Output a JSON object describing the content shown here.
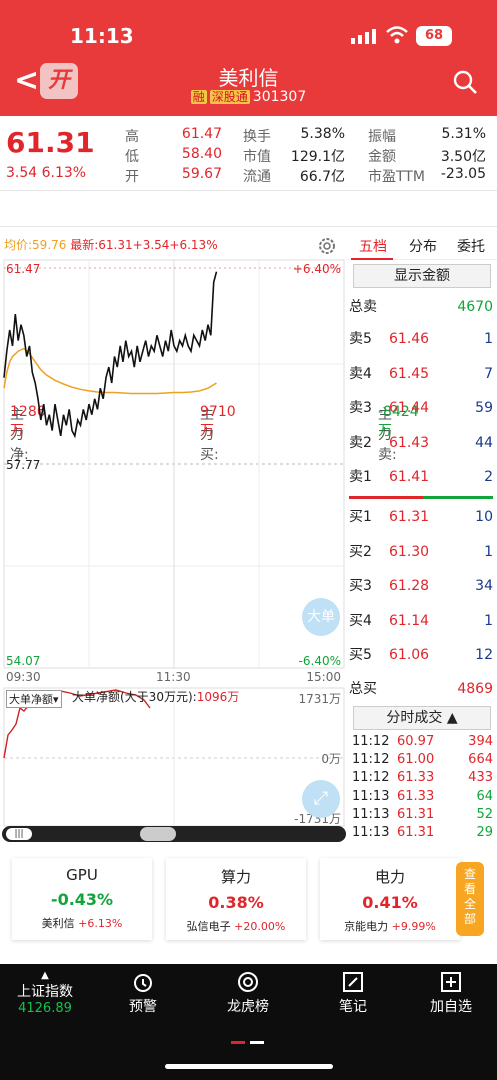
{
  "status": {
    "time": "11:13",
    "battery": "68"
  },
  "header": {
    "back_glyph": "<",
    "kai_label": "开",
    "title": "美利信",
    "tag_rong": "融",
    "tag_sgt": "深股通",
    "code": "301307"
  },
  "quote": {
    "price": "61.31",
    "change": "3.54",
    "change_pct": "6.13%",
    "fields": [
      {
        "label": "高",
        "value": "61.47",
        "color": "red"
      },
      {
        "label": "低",
        "value": "58.40",
        "color": "red"
      },
      {
        "label": "开",
        "value": "59.67",
        "color": "red"
      },
      {
        "label": "换手",
        "value": "5.38%",
        "color": "dark"
      },
      {
        "label": "市值",
        "value": "129.1亿",
        "color": "dark"
      },
      {
        "label": "流通",
        "value": "66.7亿",
        "color": "dark"
      },
      {
        "label": "振幅",
        "value": "5.31%",
        "color": "dark"
      },
      {
        "label": "金额",
        "value": "3.50亿",
        "color": "dark"
      },
      {
        "label": "市盈TTM",
        "value": "-23.05",
        "color": "dark"
      }
    ]
  },
  "flow": {
    "net_label": "主力净:",
    "net_value": "1286万",
    "buy_label": "主力买:",
    "buy_value": "9710万",
    "sell_label": "主力卖:",
    "sell_value": "-8424万"
  },
  "chart": {
    "avg_label": "均价:59.76",
    "last_label": "最新:61.31",
    "last_chg": "+3.54",
    "last_pct": "+6.13%",
    "y_top": "61.47",
    "y_mid": "57.77",
    "y_bot": "54.07",
    "pct_top": "+6.40%",
    "pct_bot": "-6.40%",
    "t_start": "09:30",
    "t_mid": "11:30",
    "t_end": "15:00",
    "big_order_btn": "大单",
    "sub_select": "大单净额",
    "sub_title": "大单净额(大于30万元):",
    "sub_value": "1096万",
    "sub_top": "1731万",
    "sub_zero": "0万",
    "sub_bot": "-1731万"
  },
  "chart_data": {
    "type": "line",
    "title": "",
    "xlabel": "",
    "ylabel": "",
    "x_ticks": [
      "09:30",
      "11:30",
      "15:00"
    ],
    "ylim": [
      54.07,
      61.47
    ],
    "series": [
      {
        "name": "price",
        "color": "#111111",
        "x": [
          0,
          2,
          4,
          6,
          8,
          10,
          12,
          14,
          16,
          18,
          20,
          22,
          24,
          26,
          28,
          30,
          32,
          34,
          36,
          38,
          40,
          42,
          44,
          46,
          48,
          50,
          52,
          54,
          56,
          58,
          60,
          62,
          64,
          66,
          68,
          70,
          72,
          74,
          76,
          78,
          80,
          82,
          84,
          86,
          88,
          90,
          92,
          94,
          96,
          98,
          100,
          102,
          104,
          106,
          108,
          110,
          112,
          114,
          116,
          118,
          120,
          122,
          124,
          126,
          128,
          130,
          132,
          134,
          136,
          138,
          140,
          142,
          144,
          146,
          148,
          150
        ],
        "values": [
          59.4,
          59.9,
          60.3,
          60.0,
          60.6,
          60.1,
          60.4,
          60.2,
          59.8,
          60.0,
          59.5,
          59.3,
          59.0,
          58.6,
          58.9,
          58.5,
          58.7,
          58.4,
          58.9,
          58.6,
          58.3,
          58.7,
          58.5,
          58.8,
          58.4,
          58.3,
          58.6,
          58.5,
          58.8,
          58.6,
          58.9,
          58.7,
          59.0,
          58.8,
          59.2,
          59.0,
          59.4,
          59.6,
          59.3,
          59.8,
          59.6,
          60.0,
          59.7,
          60.1,
          59.8,
          59.9,
          59.6,
          60.0,
          59.7,
          59.9,
          60.1,
          59.8,
          60.0,
          59.9,
          60.2,
          60.0,
          59.8,
          60.1,
          59.9,
          60.3,
          60.0,
          59.9,
          60.1,
          60.0,
          60.2,
          60.0,
          59.9,
          60.2,
          60.1,
          60.0,
          60.3,
          60.1,
          60.4,
          60.2,
          61.2,
          61.4
        ]
      },
      {
        "name": "avg",
        "color": "#f0a020",
        "x": [
          0,
          2,
          4,
          6,
          10,
          14,
          18,
          22,
          26,
          30,
          36,
          42,
          48,
          54,
          60,
          66,
          72,
          78,
          84,
          90,
          96,
          102,
          108,
          114,
          120,
          126,
          132,
          138,
          144,
          150
        ],
        "values": [
          59.2,
          59.5,
          59.7,
          59.8,
          59.9,
          59.95,
          59.85,
          59.7,
          59.55,
          59.45,
          59.35,
          59.28,
          59.22,
          59.18,
          59.15,
          59.13,
          59.12,
          59.12,
          59.11,
          59.1,
          59.1,
          59.1,
          59.1,
          59.11,
          59.12,
          59.12,
          59.13,
          59.15,
          59.2,
          59.3
        ]
      }
    ]
  },
  "book": {
    "tabs": [
      "五档",
      "分布",
      "委托"
    ],
    "show_amount": "显示金额",
    "total_sell_label": "总卖",
    "total_sell": "4670",
    "asks": [
      {
        "label": "卖5",
        "price": "61.46",
        "vol": "1"
      },
      {
        "label": "卖4",
        "price": "61.45",
        "vol": "7"
      },
      {
        "label": "卖3",
        "price": "61.44",
        "vol": "59"
      },
      {
        "label": "卖2",
        "price": "61.43",
        "vol": "44"
      },
      {
        "label": "卖1",
        "price": "61.41",
        "vol": "2"
      }
    ],
    "bids": [
      {
        "label": "买1",
        "price": "61.31",
        "vol": "10"
      },
      {
        "label": "买2",
        "price": "61.30",
        "vol": "1"
      },
      {
        "label": "买3",
        "price": "61.28",
        "vol": "34"
      },
      {
        "label": "买4",
        "price": "61.14",
        "vol": "1"
      },
      {
        "label": "买5",
        "price": "61.06",
        "vol": "12"
      }
    ],
    "total_buy_label": "总买",
    "total_buy": "4869",
    "ticks_btn": "分时成交",
    "ticks": [
      {
        "t": "11:12",
        "p": "60.97",
        "v": "394",
        "pc": "red",
        "vc": "red"
      },
      {
        "t": "11:12",
        "p": "61.00",
        "v": "664",
        "pc": "red",
        "vc": "red"
      },
      {
        "t": "11:12",
        "p": "61.33",
        "v": "433",
        "pc": "red",
        "vc": "red"
      },
      {
        "t": "11:13",
        "p": "61.33",
        "v": "64",
        "pc": "red",
        "vc": "green"
      },
      {
        "t": "11:13",
        "p": "61.31",
        "v": "52",
        "pc": "red",
        "vc": "green"
      },
      {
        "t": "11:13",
        "p": "61.31",
        "v": "29",
        "pc": "red",
        "vc": "green"
      }
    ]
  },
  "concepts": [
    {
      "name": "GPU",
      "pct": "-0.43%",
      "color": "green",
      "lead": "美利信",
      "lead_pct": "+6.13%"
    },
    {
      "name": "算力",
      "pct": "0.38%",
      "color": "red",
      "lead": "弘信电子",
      "lead_pct": "+20.00%"
    },
    {
      "name": "电力",
      "pct": "0.41%",
      "color": "red",
      "lead": "京能电力",
      "lead_pct": "+9.99%"
    }
  ],
  "more_label": "查看全部",
  "bottom": {
    "index_name": "上证指数",
    "index_value": "4126.89",
    "items": [
      "预警",
      "龙虎榜",
      "笔记",
      "加自选"
    ]
  },
  "colors": {
    "red": "#e0262b",
    "green": "#12a33b",
    "header": "#e83a3a",
    "avg": "#f0a020"
  }
}
